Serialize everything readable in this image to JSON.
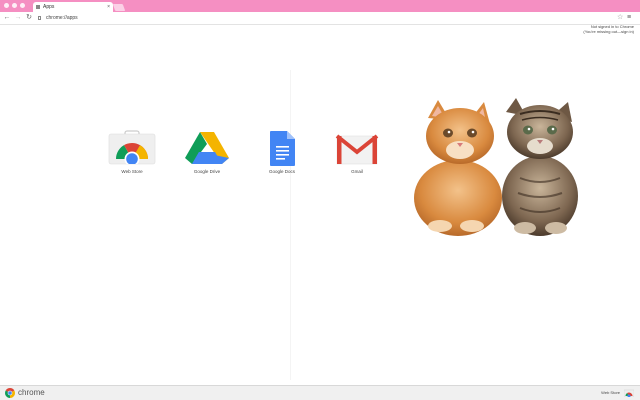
{
  "browser": {
    "tab_title": "Apps",
    "tab_close": "×",
    "url": "chrome://apps",
    "star_icon": "star-icon",
    "menu_icon": "hamburger-menu-icon"
  },
  "nav": {
    "back": "←",
    "forward": "→",
    "reload": "↻",
    "star": "☆",
    "menu": "≡"
  },
  "notice": {
    "line1": "Not signed in to Chrome",
    "line2": "(You're missing out—sign in)"
  },
  "apps": [
    {
      "label": "Web Store",
      "icon": "web-store-icon"
    },
    {
      "label": "Google Drive",
      "icon": "google-drive-icon"
    },
    {
      "label": "Google Docs",
      "icon": "google-docs-icon"
    },
    {
      "label": "Gmail",
      "icon": "gmail-icon"
    }
  ],
  "bottom": {
    "brand": "chrome",
    "store_label": "Web Store"
  },
  "colors": {
    "tabstrip": "#f58fc2",
    "chrome_red": "#db4437",
    "chrome_green": "#0f9d58",
    "chrome_yellow": "#f4b400",
    "chrome_blue": "#4285f4"
  }
}
